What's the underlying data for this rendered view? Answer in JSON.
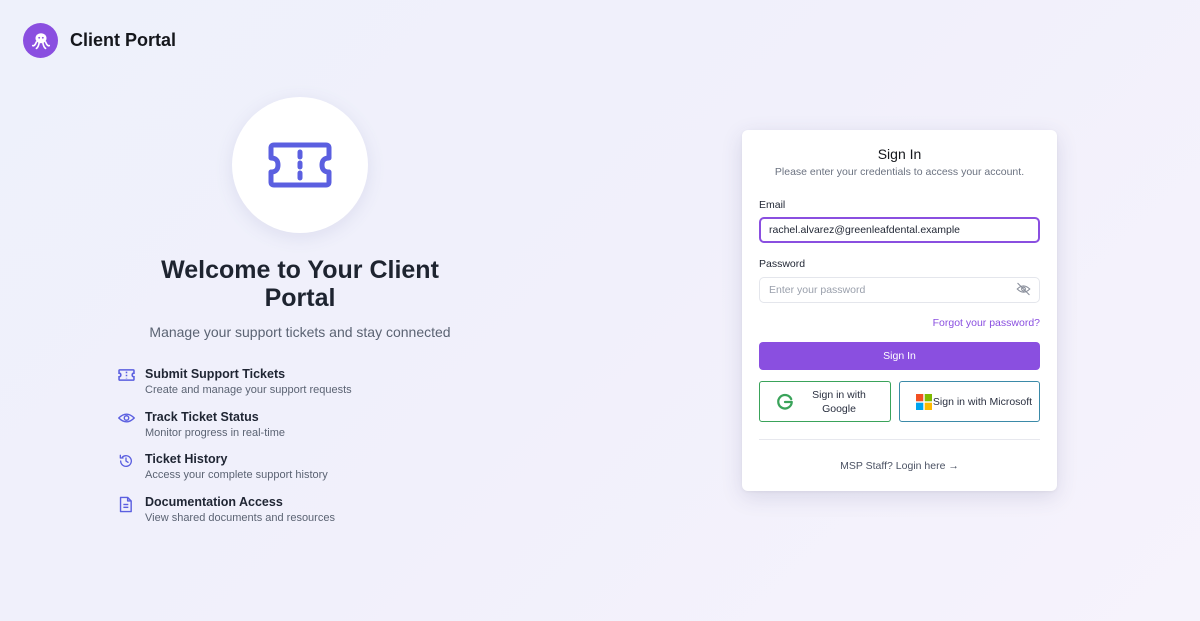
{
  "brand": {
    "title": "Client Portal"
  },
  "hero": {
    "title": "Welcome to Your Client Portal",
    "subtitle": "Manage your support tickets and stay connected"
  },
  "features": [
    {
      "icon": "ticket-icon",
      "title": "Submit Support Tickets",
      "desc": "Create and manage your support requests"
    },
    {
      "icon": "eye-icon",
      "title": "Track Ticket Status",
      "desc": "Monitor progress in real-time"
    },
    {
      "icon": "history-icon",
      "title": "Ticket History",
      "desc": "Access your complete support history"
    },
    {
      "icon": "document-icon",
      "title": "Documentation Access",
      "desc": "View shared documents and resources"
    }
  ],
  "signin": {
    "title": "Sign In",
    "subtitle": "Please enter your credentials to access your account.",
    "email_label": "Email",
    "email_value": "rachel.alvarez@greenleafdental.example",
    "password_label": "Password",
    "password_placeholder": "Enter your password",
    "forgot": "Forgot your password?",
    "button": "Sign In",
    "google": "Sign in with Google",
    "microsoft": "Sign in with Microsoft",
    "staff": "MSP Staff? Login here →"
  },
  "colors": {
    "accent": "#8a4fe0",
    "icon_blue": "#5b5fe0",
    "google_border": "#3aa35a",
    "microsoft_border": "#3b8aa8"
  }
}
